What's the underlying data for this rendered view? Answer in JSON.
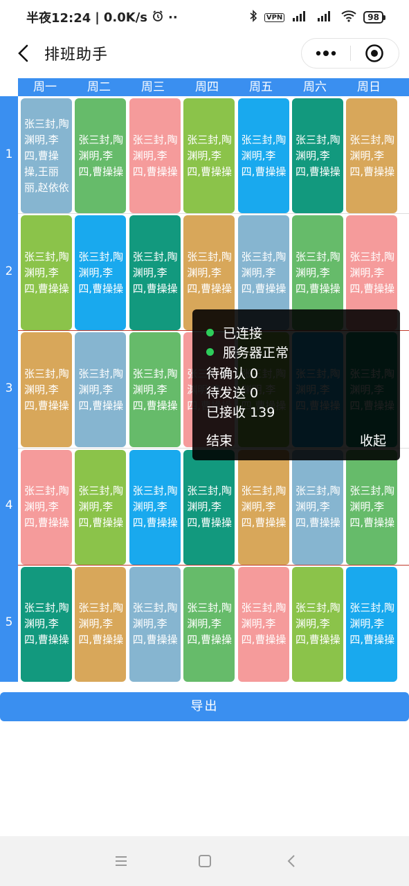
{
  "status_bar": {
    "time": "半夜12:24",
    "speed": "0.0K/s",
    "alarm_icon": "alarm-clock-icon",
    "more_dots": "··",
    "vpn": "VPN",
    "battery": "98"
  },
  "nav": {
    "title": "排班助手"
  },
  "days": [
    "周一",
    "周二",
    "周三",
    "周四",
    "周五",
    "周六",
    "周日"
  ],
  "rows": [
    "1",
    "2",
    "3",
    "4",
    "5"
  ],
  "colors": {
    "blue_gray": "#86b5d0",
    "green": "#66bb6a",
    "pink": "#f59b9b",
    "lime": "#8bc34a",
    "sky": "#19a9ee",
    "teal": "#12997e",
    "gold": "#d8a75a",
    "accent": "#3a8ff0"
  },
  "schedule": [
    [
      {
        "text": "张三封,陶渊明,李四,曹操操,王丽丽,赵依依",
        "color": "blue_gray"
      },
      {
        "text": "张三封,陶渊明,李四,曹操操",
        "color": "green"
      },
      {
        "text": "张三封,陶渊明,李四,曹操操",
        "color": "pink"
      },
      {
        "text": "张三封,陶渊明,李四,曹操操",
        "color": "lime"
      },
      {
        "text": "张三封,陶渊明,李四,曹操操",
        "color": "sky"
      },
      {
        "text": "张三封,陶渊明,李四,曹操操",
        "color": "teal"
      },
      {
        "text": "张三封,陶渊明,李四,曹操操",
        "color": "gold"
      }
    ],
    [
      {
        "text": "张三封,陶渊明,李四,曹操操",
        "color": "lime"
      },
      {
        "text": "张三封,陶渊明,李四,曹操操",
        "color": "sky"
      },
      {
        "text": "张三封,陶渊明,李四,曹操操",
        "color": "teal"
      },
      {
        "text": "张三封,陶渊明,李四,曹操操",
        "color": "gold"
      },
      {
        "text": "张三封,陶渊明,李四,曹操操",
        "color": "blue_gray"
      },
      {
        "text": "张三封,陶渊明,李四,曹操操",
        "color": "green"
      },
      {
        "text": "张三封,陶渊明,李四,曹操操",
        "color": "pink"
      }
    ],
    [
      {
        "text": "张三封,陶渊明,李四,曹操操",
        "color": "gold"
      },
      {
        "text": "张三封,陶渊明,李四,曹操操",
        "color": "blue_gray"
      },
      {
        "text": "张三封,陶渊明,李四,曹操操",
        "color": "green"
      },
      {
        "text": "张三封,陶渊明,李四,曹操操",
        "color": "pink"
      },
      {
        "text": "张三封,陶渊明,李四,曹操操",
        "color": "lime"
      },
      {
        "text": "张三封,陶渊明,李四,曹操操",
        "color": "sky"
      },
      {
        "text": "张三封,陶渊明,李四,曹操操",
        "color": "teal"
      }
    ],
    [
      {
        "text": "张三封,陶渊明,李四,曹操操",
        "color": "pink"
      },
      {
        "text": "张三封,陶渊明,李四,曹操操",
        "color": "lime"
      },
      {
        "text": "张三封,陶渊明,李四,曹操操",
        "color": "sky"
      },
      {
        "text": "张三封,陶渊明,李四,曹操操",
        "color": "teal"
      },
      {
        "text": "张三封,陶渊明,李四,曹操操",
        "color": "gold"
      },
      {
        "text": "张三封,陶渊明,李四,曹操操",
        "color": "blue_gray"
      },
      {
        "text": "张三封,陶渊明,李四,曹操操",
        "color": "green"
      }
    ],
    [
      {
        "text": "张三封,陶渊明,李四,曹操操",
        "color": "teal"
      },
      {
        "text": "张三封,陶渊明,李四,曹操操",
        "color": "gold"
      },
      {
        "text": "张三封,陶渊明,李四,曹操操",
        "color": "blue_gray"
      },
      {
        "text": "张三封,陶渊明,李四,曹操操",
        "color": "green"
      },
      {
        "text": "张三封,陶渊明,李四,曹操操",
        "color": "pink"
      },
      {
        "text": "张三封,陶渊明,李四,曹操操",
        "color": "lime"
      },
      {
        "text": "张三封,陶渊明,李四,曹操操",
        "color": "sky"
      }
    ]
  ],
  "debug_panel": {
    "connected": "已连接",
    "server_ok": "服务器正常",
    "pending_confirm": "待确认 0",
    "pending_send": "待发送 0",
    "received": "已接收 139",
    "end_label": "结束",
    "collapse_label": "收起"
  },
  "export_label": "导出"
}
